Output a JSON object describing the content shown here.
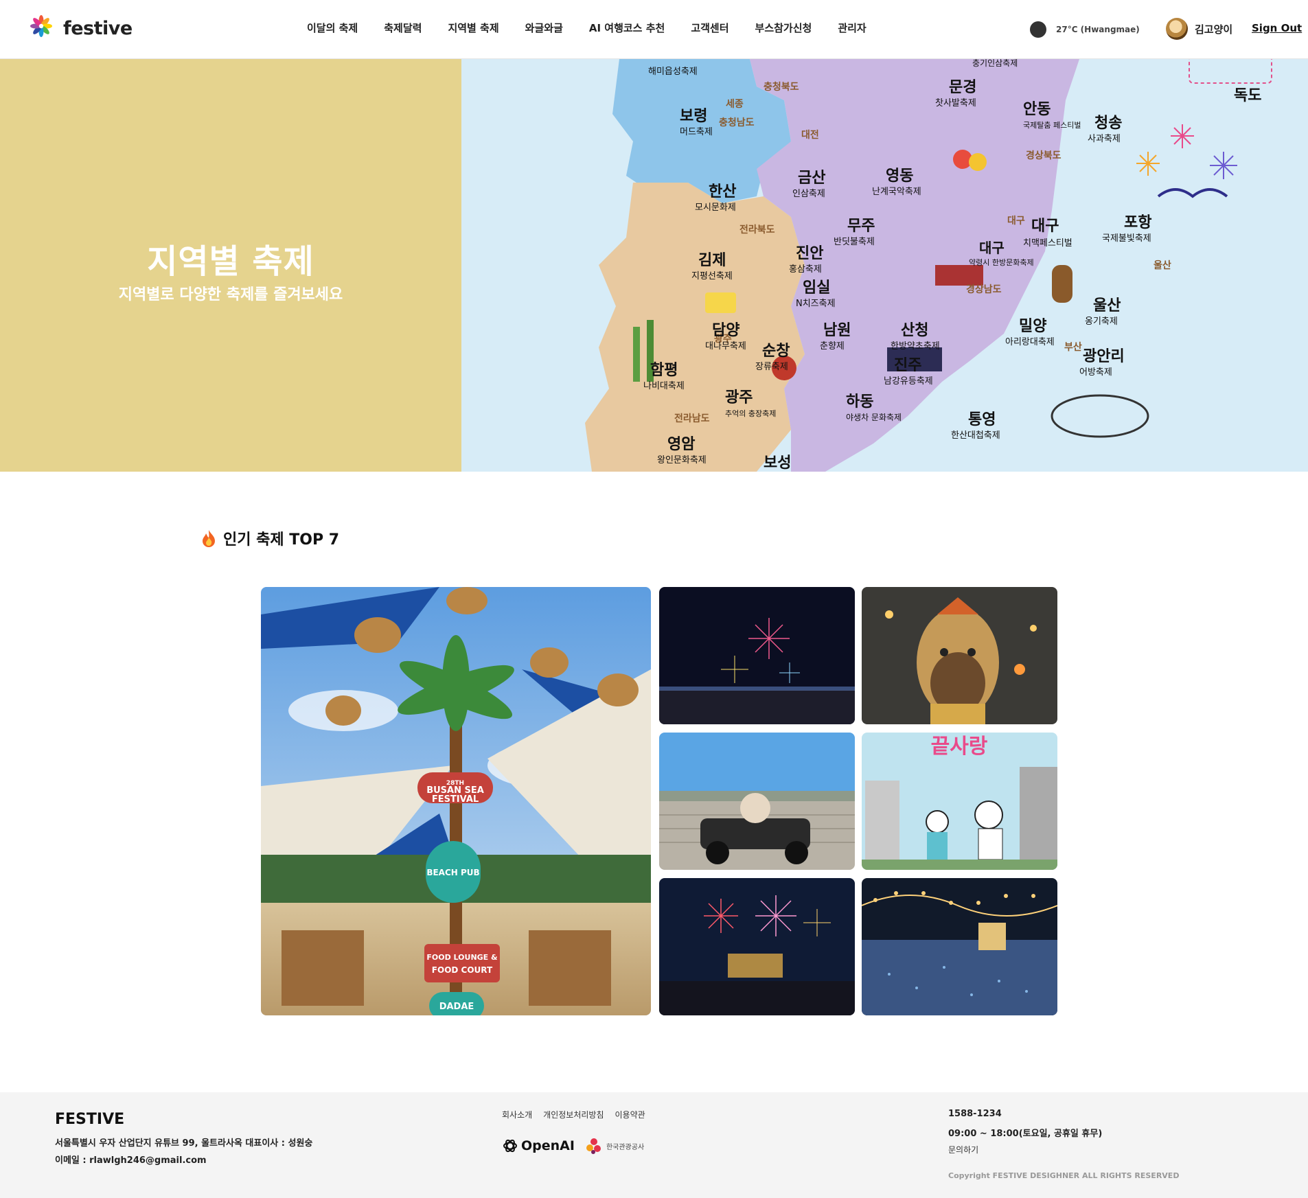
{
  "header": {
    "logo_text": "festive",
    "nav": [
      "이달의 축제",
      "축제달력",
      "지역별 축제",
      "와글와글",
      "AI 여행코스 추천",
      "고객센터",
      "부스참가신청",
      "관리자"
    ],
    "weather": "27°C (Hwangmae)",
    "user_name": "김고양이",
    "signout": "Sign Out"
  },
  "hero": {
    "title": "지역별 축제",
    "subtitle": "지역별로 다양한 축제를 즐겨보세요",
    "map_labels": {
      "regions": [
        "충청남도",
        "충청북도",
        "세종",
        "대전",
        "전라북도",
        "경상북도",
        "대구",
        "울산",
        "경상남도",
        "광주",
        "전라남도",
        "부산"
      ],
      "cities": [
        {
          "city": "보령",
          "festival": "머드축제"
        },
        {
          "city": "한산",
          "festival": "모시문화제"
        },
        {
          "city": "금산",
          "festival": "인삼축제"
        },
        {
          "city": "영동",
          "festival": "난계국악축제"
        },
        {
          "city": "문경",
          "festival": "찻사발축제"
        },
        {
          "city": "안동",
          "festival": "국제탈춤 페스티벌"
        },
        {
          "city": "청송",
          "festival": "사과축제"
        },
        {
          "city": "포항",
          "festival": "국제불빛축제"
        },
        {
          "city": "대구",
          "festival": "치맥페스티벌"
        },
        {
          "city": "무주",
          "festival": "반딧불축제"
        },
        {
          "city": "김제",
          "festival": "지평선축제"
        },
        {
          "city": "진안",
          "festival": "홍삼축제"
        },
        {
          "city": "임실",
          "festival": "N치즈축제"
        },
        {
          "city": "담양",
          "festival": "대나무축제"
        },
        {
          "city": "순창",
          "festival": "장류축제"
        },
        {
          "city": "남원",
          "festival": "춘향제"
        },
        {
          "city": "함평",
          "festival": "나비대축제"
        },
        {
          "city": "광주",
          "festival": "추억의 충장축제"
        },
        {
          "city": "영암",
          "festival": "왕인문화축제"
        },
        {
          "city": "보성",
          "festival": ""
        },
        {
          "city": "산청",
          "festival": "한방약초축제"
        },
        {
          "city": "진주",
          "festival": "남강유등축제"
        },
        {
          "city": "하동",
          "festival": "야생차 문화축제"
        },
        {
          "city": "통영",
          "festival": "한산대첩축제"
        },
        {
          "city": "밀양",
          "festival": "아리랑대축제"
        },
        {
          "city": "울산",
          "festival": "옹기축제"
        },
        {
          "city": "광안리",
          "festival": "어방축제"
        },
        {
          "city": "대구",
          "festival": "약령시 한방문화축제"
        },
        {
          "city": "독도",
          "festival": ""
        }
      ],
      "partial_top": [
        "해미읍성축제",
        "충기인삼축제"
      ]
    }
  },
  "top7": {
    "title": "인기 축제 TOP 7",
    "items": [
      {
        "id": "busan-sea-festival",
        "sign_lines": [
          "28TH",
          "BUSAN SEA",
          "FESTIVAL",
          "BEACH PUB",
          "FOOD LOUNGE &",
          "FOOD COURT",
          "DADAE"
        ]
      },
      {
        "id": "fireworks-crowd"
      },
      {
        "id": "mascot-statue"
      },
      {
        "id": "go-kart"
      },
      {
        "id": "poster-illustration",
        "poster_title": "끝사랑"
      },
      {
        "id": "fireworks-fountain"
      },
      {
        "id": "light-festival"
      }
    ]
  },
  "footer": {
    "brand": "FESTIVE",
    "address": "서울특별시 우자 산업단지 유튜브 99, 울트라사옥 대표이사 : 성원숭",
    "email": "이메일 : rlawlgh246@gmail.com",
    "links": [
      "회사소개",
      "개인정보처리방침",
      "이용약관"
    ],
    "partners": {
      "openai": "OpenAI",
      "kto": "한국관광공사"
    },
    "phone": "1588-1234",
    "hours": "09:00 ~ 18:00(토요일, 공휴일 휴무)",
    "inquiry": "문의하기",
    "copyright": "Copyright FESTIVE DESIGHNER ALL RIGHTS RESERVED"
  },
  "colors": {
    "hero_bg": "#e5d38e",
    "sea": "#d7ecf7",
    "chungcheong": "#8ec5ea",
    "jeolla": "#e8c9a0",
    "gyeongsang": "#c9b7e2",
    "footer_bg": "#f4f4f4"
  }
}
